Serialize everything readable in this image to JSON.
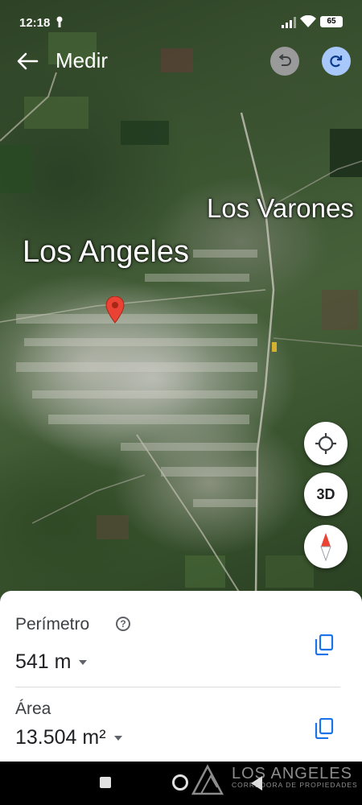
{
  "status_bar": {
    "time": "12:18",
    "battery": "65",
    "icons": [
      "person-pin-icon",
      "signal-icon",
      "wifi-icon",
      "battery-icon"
    ]
  },
  "toolbar": {
    "title": "Medir",
    "back_icon": "arrow-left-icon",
    "undo_icon": "undo-icon",
    "redo_icon": "redo-icon"
  },
  "map": {
    "labels": [
      "Los Varones",
      "Los Angeles"
    ],
    "marker_icon": "red-location-pin-icon"
  },
  "map_controls": {
    "location_icon": "my-location-icon",
    "three_d_label": "3D",
    "compass_icon": "compass-icon"
  },
  "measurement": {
    "perimeter_label": "Perímetro",
    "perimeter_value": "541 m",
    "area_label": "Área",
    "area_value": "13.504 m²",
    "help_icon": "question-icon",
    "copy_icon": "copy-icon"
  },
  "watermark": {
    "brand": "LOS ANGELES",
    "subtitle": "CORREDORA DE PROPIEDADES"
  },
  "colors": {
    "redo_bg": "#a8c7fa",
    "undo_bg": "#9a9a9a",
    "copy_blue": "#1a73e8",
    "marker_red": "#ea4335"
  }
}
